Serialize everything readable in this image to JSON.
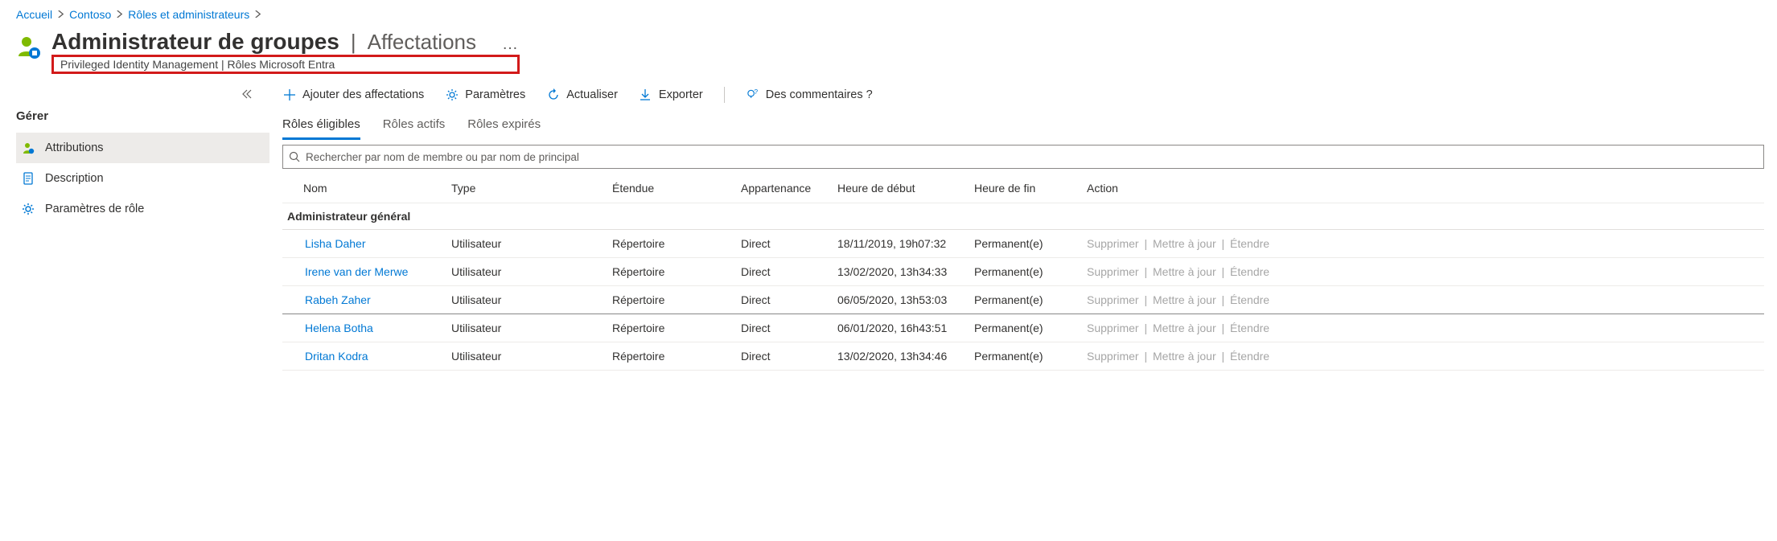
{
  "breadcrumb": {
    "items": [
      "Accueil",
      "Contoso",
      "Rôles et administrateurs"
    ]
  },
  "header": {
    "title": "Administrateur de groupes",
    "subtitle": "Affectations",
    "context_bar": "Privileged Identity Management | Rôles Microsoft Entra"
  },
  "sidebar": {
    "section_label": "Gérer",
    "items": [
      {
        "label": "Attributions",
        "active": true
      },
      {
        "label": "Description",
        "active": false
      },
      {
        "label": "Paramètres de rôle",
        "active": false
      }
    ]
  },
  "toolbar": {
    "add": "Ajouter des affectations",
    "settings": "Paramètres",
    "refresh": "Actualiser",
    "export": "Exporter",
    "feedback": "Des commentaires ?"
  },
  "tabs": {
    "eligible": "Rôles éligibles",
    "active": "Rôles actifs",
    "expired": "Rôles expirés"
  },
  "search": {
    "placeholder": "Rechercher par nom de membre ou par nom de principal"
  },
  "columns": {
    "name": "Nom",
    "type": "Type",
    "scope": "Étendue",
    "membership": "Appartenance",
    "start": "Heure de début",
    "end": "Heure de fin",
    "action": "Action"
  },
  "group_label": "Administrateur général",
  "action_labels": {
    "remove": "Supprimer",
    "update": "Mettre à jour",
    "extend": "Étendre"
  },
  "rows": [
    {
      "name": "Lisha Daher",
      "type": "Utilisateur",
      "scope": "Répertoire",
      "membership": "Direct",
      "start": "18/11/2019, 19h07:32",
      "end": "Permanent(e)",
      "hovered": false
    },
    {
      "name": "Irene van der Merwe",
      "type": "Utilisateur",
      "scope": "Répertoire",
      "membership": "Direct",
      "start": "13/02/2020, 13h34:33",
      "end": "Permanent(e)",
      "hovered": false
    },
    {
      "name": "Rabeh Zaher",
      "type": "Utilisateur",
      "scope": "Répertoire",
      "membership": "Direct",
      "start": "06/05/2020, 13h53:03",
      "end": "Permanent(e)",
      "hovered": true
    },
    {
      "name": "Helena Botha",
      "type": "Utilisateur",
      "scope": "Répertoire",
      "membership": "Direct",
      "start": "06/01/2020, 16h43:51",
      "end": "Permanent(e)",
      "hovered": false
    },
    {
      "name": "Dritan Kodra",
      "type": "Utilisateur",
      "scope": "Répertoire",
      "membership": "Direct",
      "start": "13/02/2020, 13h34:46",
      "end": "Permanent(e)",
      "hovered": false
    }
  ]
}
